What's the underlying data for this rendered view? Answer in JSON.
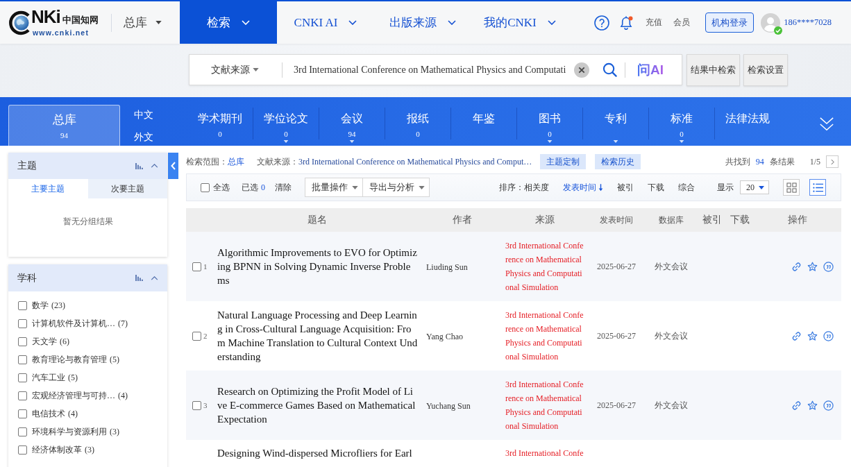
{
  "header": {
    "logo": {
      "letters": "NKi",
      "chinese": "中国知网",
      "url": "www.cnki.net"
    },
    "library": "总库",
    "nav": [
      {
        "label": "检索",
        "selected": true
      },
      {
        "label": "CNKI AI",
        "selected": false
      },
      {
        "label": "出版来源",
        "selected": false
      },
      {
        "label": "我的CNKI",
        "selected": false
      }
    ],
    "bell_unread": true,
    "links": [
      "充值",
      "会员"
    ],
    "login_button": "机构登录",
    "user": {
      "name": "186****7028",
      "verified": true
    }
  },
  "search": {
    "field": "文献来源",
    "value": "3rd International Conference on Mathematical Physics and Computati",
    "ai_label": "问AI",
    "buttons": [
      "结果中检索",
      "检索设置"
    ]
  },
  "categories": {
    "all": {
      "label": "总库",
      "count": "94",
      "selected": true
    },
    "languages": [
      "中文",
      "外文"
    ],
    "items": [
      {
        "label": "学术期刊",
        "count": "0",
        "dropdown": false,
        "selected": false
      },
      {
        "label": "学位论文",
        "count": "0",
        "dropdown": true,
        "selected": false
      },
      {
        "label": "会议",
        "count": "94",
        "dropdown": true,
        "selected": false
      },
      {
        "label": "报纸",
        "count": "0",
        "dropdown": false,
        "selected": false
      },
      {
        "label": "年鉴",
        "dropdown": false,
        "selected": false
      },
      {
        "label": "图书",
        "count": "0",
        "dropdown": true,
        "selected": false
      },
      {
        "label": "专利",
        "dropdown": true,
        "selected": false
      },
      {
        "label": "标准",
        "count": "0",
        "dropdown": true,
        "selected": false
      },
      {
        "label": "法律法规",
        "dropdown": false,
        "selected": false
      }
    ]
  },
  "sidebar": {
    "panels": [
      {
        "title": "主题",
        "expanded": true,
        "tabs": [
          {
            "label": "主要主题",
            "selected": true
          },
          {
            "label": "次要主题",
            "selected": false
          }
        ],
        "empty_text": "暂无分组结果"
      },
      {
        "title": "学科",
        "expanded": true,
        "items": [
          {
            "label": "数学",
            "count": "(23)",
            "checked": false
          },
          {
            "label": "计算机软件及计算机…",
            "count": "(7)",
            "checked": false
          },
          {
            "label": "天文学",
            "count": "(6)",
            "checked": false
          },
          {
            "label": "教育理论与教育管理",
            "count": "(5)",
            "checked": false
          },
          {
            "label": "汽车工业",
            "count": "(5)",
            "checked": false
          },
          {
            "label": "宏观经济管理与可持…",
            "count": "(4)",
            "checked": false
          },
          {
            "label": "电信技术",
            "count": "(4)",
            "checked": false
          },
          {
            "label": "环境科学与资源利用",
            "count": "(3)",
            "checked": false
          },
          {
            "label": "经济体制改革",
            "count": "(3)",
            "checked": false
          }
        ]
      }
    ]
  },
  "results": {
    "scope": {
      "label": "检索范围：",
      "value": "总库"
    },
    "source": {
      "label": "文献来源：",
      "value": "3rd International Conference on Mathematical Physics and Comput…"
    },
    "tags": [
      "主题定制",
      "检索历史"
    ],
    "total": {
      "prefix": "共找到",
      "count": "94",
      "suffix": "条结果"
    },
    "page": "1/5",
    "toolbar": {
      "select_all": {
        "label": "全选",
        "checked": false
      },
      "selected_label": "已选",
      "selected_count": "0",
      "clear": "清除",
      "menus": [
        "批量操作",
        "导出与分析"
      ],
      "sort_label": "排序：",
      "sort_options": [
        {
          "label": "相关度",
          "selected": false
        },
        {
          "label": "发表时间",
          "selected": true
        },
        {
          "label": "被引",
          "selected": false
        },
        {
          "label": "下载",
          "selected": false
        },
        {
          "label": "综合",
          "selected": false
        }
      ],
      "display_label": "显示",
      "page_size": "20",
      "views": [
        {
          "kind": "grid",
          "selected": false
        },
        {
          "kind": "list",
          "selected": true
        }
      ]
    },
    "table": {
      "columns": [
        "题名",
        "作者",
        "来源",
        "发表时间",
        "数据库",
        "被引",
        "下载",
        "操作"
      ],
      "rows": [
        {
          "number": "1",
          "checked": false,
          "title": "Algorithmic Improvements to EVO for Optimizing BPNN in Solving Dynamic Inverse Problems",
          "author": "Liuding Sun",
          "source": "3rd International Conference on Mathematical Physics and Computational Simulation",
          "date": "2025-06-27",
          "database": "外文会议"
        },
        {
          "number": "2",
          "checked": false,
          "title": "Natural Language Processing and Deep Learning in Cross-Cultural Language Acquisition: From Machine Translation to Cultural Context Understanding",
          "author": "Yang Chao",
          "source": "3rd International Conference on Mathematical Physics and Computational Simulation",
          "date": "2025-06-27",
          "database": "外文会议"
        },
        {
          "number": "3",
          "checked": false,
          "title": "Research on Optimizing the Profit Model of Live E-commerce Games Based on Mathematical Expectation",
          "author": "Yuchang Sun",
          "source": "3rd International Conference on Mathematical Physics and Computational Simulation",
          "date": "2025-06-27",
          "database": "外文会议"
        },
        {
          "title": "Designing Wind-dispersed Microfliers for Earl",
          "source": "3rd International Confe"
        }
      ]
    }
  }
}
